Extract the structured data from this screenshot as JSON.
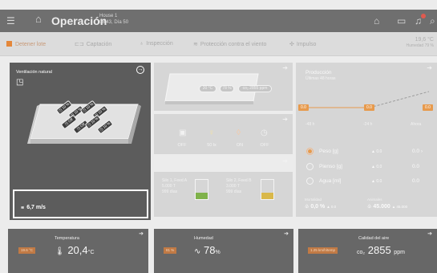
{
  "header": {
    "title": "Operación",
    "house": "House 1",
    "datetime": "08:43, Día 50"
  },
  "toolbar": {
    "stop_label": "Detener lote",
    "captacion_label": "Captación",
    "inspeccion_label": "Inspección",
    "proteccion_label": "Protección contra el viento",
    "impulso_label": "Impulso",
    "outside_temp": "19,6 °C",
    "outside_humidity": "Humedad 79 %"
  },
  "ventilation": {
    "title": "Ventilación natural",
    "wind_speed": "6,7 m/s",
    "inlets": [
      {
        "label": "10 %"
      },
      {
        "label": "10 %"
      },
      {
        "label": "10 %"
      },
      {
        "label": "10 %"
      },
      {
        "label": "Off"
      },
      {
        "label": "Off"
      },
      {
        "label": "10 %"
      },
      {
        "label": "10 %"
      }
    ]
  },
  "house_view": {
    "temp_pill": "20 °C",
    "humidity_pill": "78 %",
    "co2_pill": "co₂ 2855 ppm"
  },
  "equipment": {
    "items": [
      {
        "icon": "heater-icon",
        "status": "OFF"
      },
      {
        "icon": "light-bulb-icon",
        "status": "50 lx"
      },
      {
        "icon": "water-drop-icon",
        "status": "ON"
      },
      {
        "icon": "timer-icon",
        "status": "OFF"
      }
    ]
  },
  "silos": [
    {
      "name": "Silo 1, Feed A",
      "amount": "5.000 T",
      "days": "999 días",
      "fill_color": "#7fb24a"
    },
    {
      "name": "Silo 2, Feed B",
      "amount": "3.000 T",
      "days": "999 días",
      "fill_color": "#d9b84a"
    }
  ],
  "production": {
    "title": "Producción",
    "subtitle": "Últimas 48 horas",
    "tick_labels": [
      "-48 h",
      "-24 h",
      "Ahora"
    ],
    "point_labels": [
      "0.0",
      "0.0",
      "0.0"
    ],
    "rows": [
      {
        "label": "Peso [g]",
        "delta": "▲ 0.0",
        "value": "0.0 ›",
        "selected": true
      },
      {
        "label": "Pienso [g]",
        "delta": "▲ 0.0",
        "value": "0.0",
        "selected": false
      },
      {
        "label": "Agua [ml]",
        "delta": "▲ 0.0",
        "value": "0.0",
        "selected": false
      }
    ],
    "mortality_label": "Mortalidad",
    "mortality_value": "0,0 %",
    "mortality_delta": "▲ 0.0",
    "animals_label": "Animales",
    "animals_value": "45.000",
    "animals_delta": "▲ 45.000"
  },
  "bottom": {
    "temperature": {
      "title": "Temperatura",
      "pill": "19.6 °C",
      "value": "20,4",
      "unit": "°C"
    },
    "humidity": {
      "title": "Humedad",
      "pill": "81 %",
      "value": "78",
      "unit": "%"
    },
    "air_quality": {
      "title": "Calidad del aire",
      "pill": "1.25 km/h/temp",
      "prefix": "co₂",
      "value": "2855",
      "unit": "ppm"
    }
  },
  "colors": {
    "accent": "#e4873a",
    "dark_panel": "#5c5c5c",
    "faded_card": "#d6d6d6"
  }
}
